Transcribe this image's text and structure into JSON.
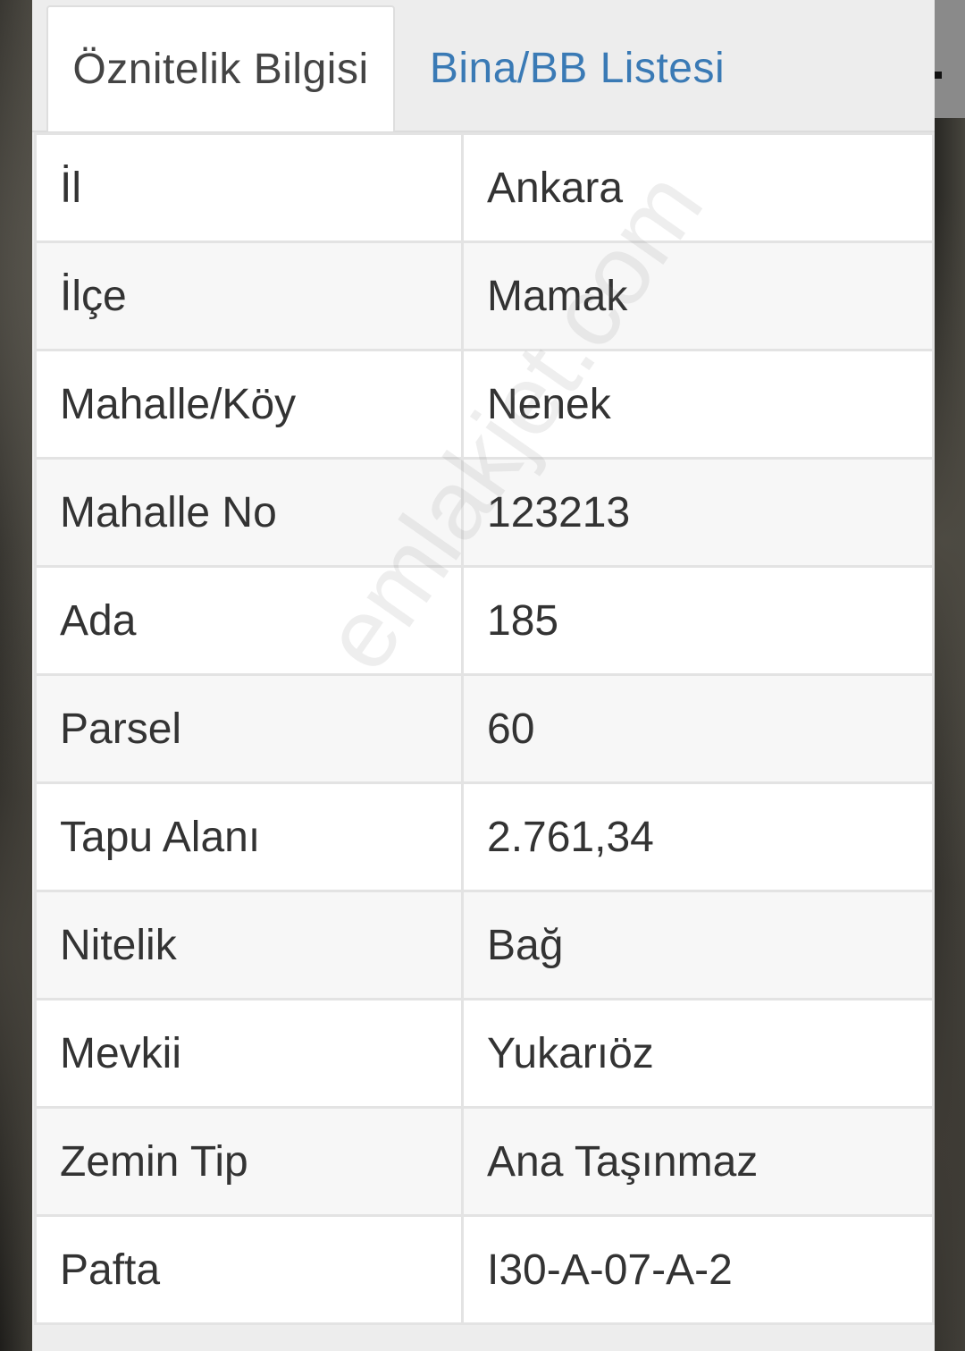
{
  "tabs": [
    {
      "label": "Öznitelik Bilgisi",
      "active": true
    },
    {
      "label": "Bina/BB Listesi",
      "active": false
    }
  ],
  "rows": [
    {
      "label": "İl",
      "value": "Ankara"
    },
    {
      "label": "İlçe",
      "value": "Mamak"
    },
    {
      "label": "Mahalle/Köy",
      "value": "Nenek"
    },
    {
      "label": "Mahalle No",
      "value": "123213"
    },
    {
      "label": "Ada",
      "value": "185"
    },
    {
      "label": "Parsel",
      "value": "60"
    },
    {
      "label": "Tapu Alanı",
      "value": "2.761,34"
    },
    {
      "label": "Nitelik",
      "value": "Bağ"
    },
    {
      "label": "Mevkii",
      "value": "Yukarıöz"
    },
    {
      "label": "Zemin Tip",
      "value": "Ana Taşınmaz"
    },
    {
      "label": "Pafta",
      "value": "I30-A-07-A-2"
    }
  ],
  "watermark": "emlakjet.com",
  "colors": {
    "active_tab_text": "#444444",
    "inactive_tab_text": "#3a7ab5",
    "cell_text": "#333333",
    "border": "#e3e3e3"
  }
}
